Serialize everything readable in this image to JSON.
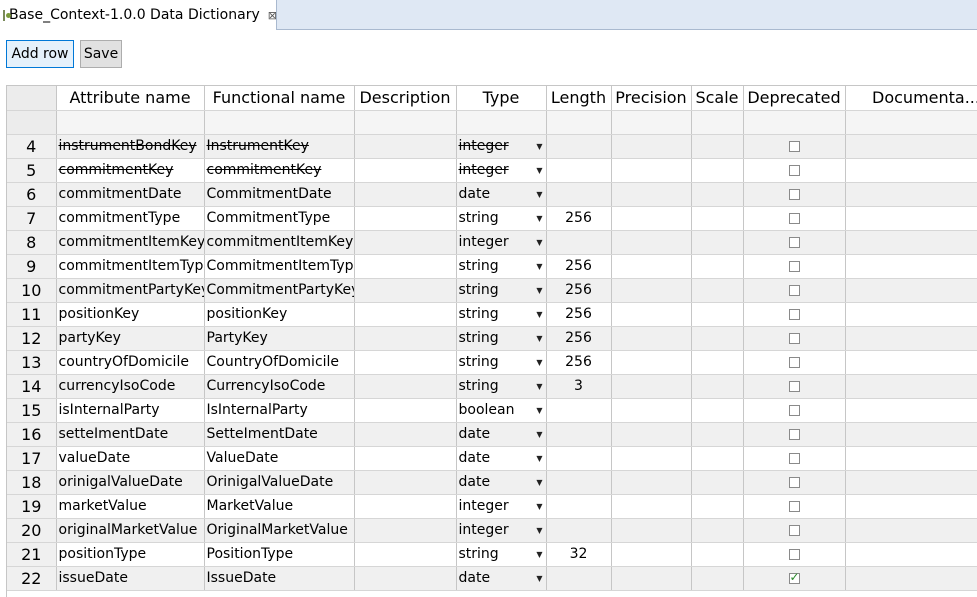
{
  "editor": {
    "tab_title": "Base_Context-1.0.0 Data Dictionary",
    "close_glyph": "⊠"
  },
  "toolbar": {
    "add_row_label": "Add row",
    "save_label": "Save"
  },
  "table": {
    "columns": [
      "Attribute name",
      "Functional name",
      "Description",
      "Type",
      "Length",
      "Precision",
      "Scale",
      "Deprecated",
      "Documenta..."
    ],
    "rows": [
      {
        "num": "4",
        "attribute": "instrumentBondKey",
        "functional": "InstrumentKey",
        "type": "integer",
        "length": "",
        "deprecated": false,
        "strikethrough": true
      },
      {
        "num": "5",
        "attribute": "commitmentKey",
        "functional": "commitmentKey",
        "type": "integer",
        "length": "",
        "deprecated": false,
        "strikethrough": true
      },
      {
        "num": "6",
        "attribute": "commitmentDate",
        "functional": "CommitmentDate",
        "type": "date",
        "length": "",
        "deprecated": false,
        "strikethrough": false
      },
      {
        "num": "7",
        "attribute": "commitmentType",
        "functional": "CommitmentType",
        "type": "string",
        "length": "256",
        "deprecated": false,
        "strikethrough": false
      },
      {
        "num": "8",
        "attribute": "commitmentItemKey",
        "functional": "commitmentItemKey",
        "type": "integer",
        "length": "",
        "deprecated": false,
        "strikethrough": false
      },
      {
        "num": "9",
        "attribute": "commitmentItemType",
        "functional": "CommitmentItemType",
        "type": "string",
        "length": "256",
        "deprecated": false,
        "strikethrough": false
      },
      {
        "num": "10",
        "attribute": "commitmentPartyKey",
        "functional": "CommitmentPartyKey",
        "type": "string",
        "length": "256",
        "deprecated": false,
        "strikethrough": false
      },
      {
        "num": "11",
        "attribute": "positionKey",
        "functional": "positionKey",
        "type": "string",
        "length": "256",
        "deprecated": false,
        "strikethrough": false
      },
      {
        "num": "12",
        "attribute": "partyKey",
        "functional": "PartyKey",
        "type": "string",
        "length": "256",
        "deprecated": false,
        "strikethrough": false
      },
      {
        "num": "13",
        "attribute": "countryOfDomicile",
        "functional": "CountryOfDomicile",
        "type": "string",
        "length": "256",
        "deprecated": false,
        "strikethrough": false
      },
      {
        "num": "14",
        "attribute": "currencyIsoCode",
        "functional": "CurrencyIsoCode",
        "type": "string",
        "length": "3",
        "deprecated": false,
        "strikethrough": false
      },
      {
        "num": "15",
        "attribute": "isInternalParty",
        "functional": "IsInternalParty",
        "type": "boolean",
        "length": "",
        "deprecated": false,
        "strikethrough": false
      },
      {
        "num": "16",
        "attribute": "setteImentDate",
        "functional": "SetteImentDate",
        "type": "date",
        "length": "",
        "deprecated": false,
        "strikethrough": false
      },
      {
        "num": "17",
        "attribute": "valueDate",
        "functional": "ValueDate",
        "type": "date",
        "length": "",
        "deprecated": false,
        "strikethrough": false
      },
      {
        "num": "18",
        "attribute": "orinigalValueDate",
        "functional": "OrinigalValueDate",
        "type": "date",
        "length": "",
        "deprecated": false,
        "strikethrough": false
      },
      {
        "num": "19",
        "attribute": "marketValue",
        "functional": "MarketValue",
        "type": "integer",
        "length": "",
        "deprecated": false,
        "strikethrough": false
      },
      {
        "num": "20",
        "attribute": "originalMarketValue",
        "functional": "OriginalMarketValue",
        "type": "integer",
        "length": "",
        "deprecated": false,
        "strikethrough": false
      },
      {
        "num": "21",
        "attribute": "positionType",
        "functional": "PositionType",
        "type": "string",
        "length": "32",
        "deprecated": false,
        "strikethrough": false
      },
      {
        "num": "22",
        "attribute": "issueDate",
        "functional": "IssueDate",
        "type": "date",
        "length": "",
        "deprecated": true,
        "strikethrough": false
      }
    ]
  }
}
